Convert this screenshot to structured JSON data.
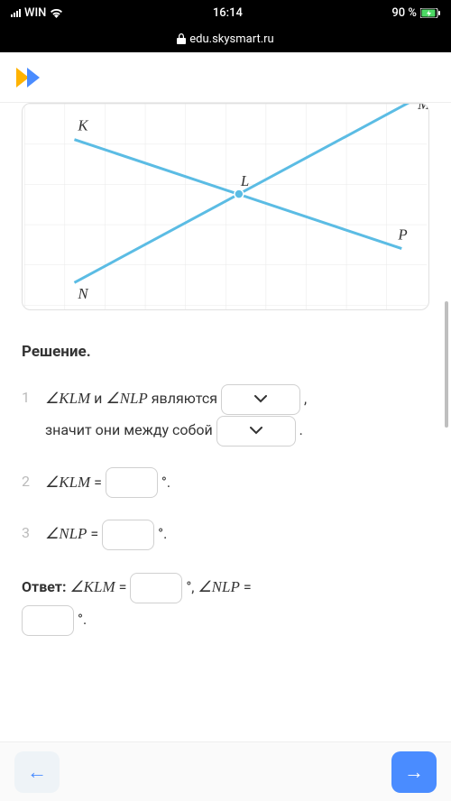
{
  "status": {
    "carrier": "WIN",
    "time": "16:14",
    "battery": "90 %"
  },
  "url_bar": {
    "domain": "edu.skysmart.ru"
  },
  "diagram": {
    "labels": {
      "K": "K",
      "L": "L",
      "M": "M",
      "N": "N",
      "P": "P"
    }
  },
  "solution": {
    "title": "Решение.",
    "steps": {
      "s1": {
        "num": "1",
        "angle1": "∠KLM",
        "conj": " и ",
        "angle2": "∠NLP",
        "verb": " являются ",
        "line2a": "значит они между собой "
      },
      "s2": {
        "num": "2",
        "angle": "∠KLM",
        "eq": " = ",
        "deg": "°."
      },
      "s3": {
        "num": "3",
        "angle": "∠NLP",
        "eq": " = ",
        "deg": "°."
      }
    },
    "answer": {
      "label": "Ответ: ",
      "a1": "∠KLM",
      "eq1": " = ",
      "deg1": "°, ",
      "a2": "∠NLP",
      "eq2": " = ",
      "deg2": "°."
    },
    "punct": {
      "comma": ",",
      "period": "."
    }
  }
}
